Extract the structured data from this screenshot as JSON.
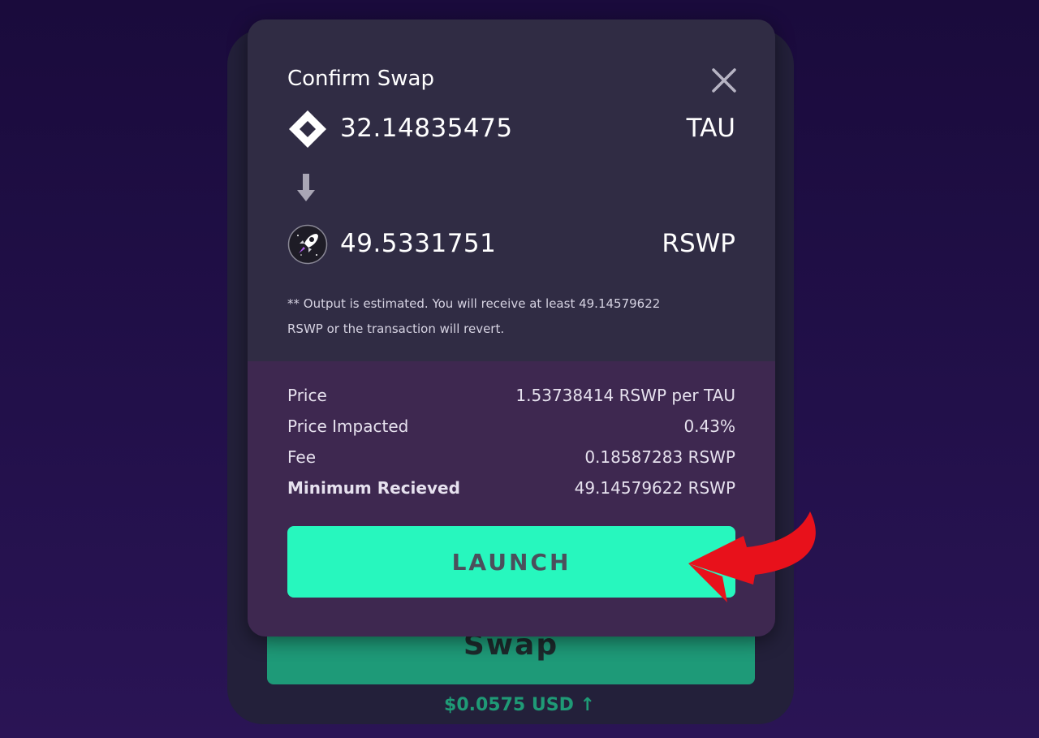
{
  "background": {
    "swap_label": "Swap",
    "usd_value": "$0.0575 USD ↑"
  },
  "modal": {
    "title": "Confirm Swap",
    "close_icon": "close-icon",
    "from": {
      "amount": "32.14835475",
      "symbol": "TAU",
      "icon": "tau-diamond-icon"
    },
    "arrow_icon": "arrow-down-icon",
    "to": {
      "amount": "49.5331751",
      "symbol": "RSWP",
      "icon": "rocket-icon"
    },
    "note_line1": "** Output is estimated. You will receive at least 49.14579622",
    "note_line2": "RSWP or the transaction will revert.",
    "details": [
      {
        "label": "Price",
        "value": "1.53738414 RSWP per TAU"
      },
      {
        "label": "Price Impacted",
        "value": "0.43%"
      },
      {
        "label": "Fee",
        "value": "0.18587283 RSWP"
      },
      {
        "label": "Minimum Recieved",
        "value": "49.14579622 RSWP"
      }
    ],
    "launch_label": "LAUNCH"
  },
  "annotation": {
    "icon": "red-curved-arrow-icon"
  },
  "colors": {
    "page_bg": "#1a0b3c",
    "modal_top": "#302c44",
    "modal_bottom": "#3e2850",
    "launch_button": "#27f7be",
    "swap_button": "#1e9a78",
    "usd_text": "#1f9a76",
    "annotation_arrow": "#e8111b"
  }
}
